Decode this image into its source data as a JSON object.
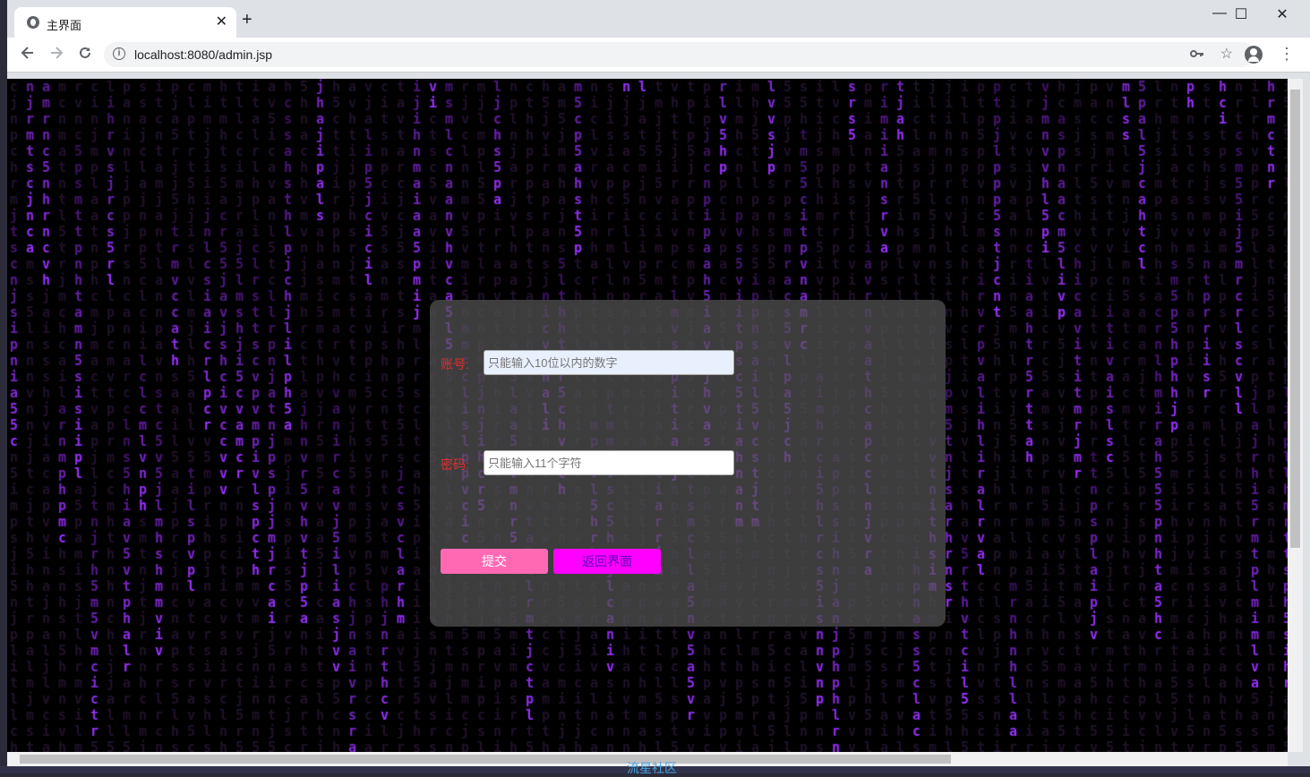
{
  "browser": {
    "tab_title": "主界面",
    "tab_close": "✕",
    "new_tab": "+",
    "url": "localhost:8080/admin.jsp",
    "window_controls": [
      "—",
      "☐",
      "✕"
    ]
  },
  "icons": {
    "back": "arrow-left-icon",
    "forward": "arrow-right-icon",
    "reload": "reload-icon",
    "info": "info-icon",
    "key": "key-icon",
    "star": "star-icon",
    "account": "account-icon",
    "menu": "kebab-menu-icon"
  },
  "form": {
    "account_label": "账号:",
    "account_placeholder": "只能输入10位以内的数字",
    "password_label": "密码:",
    "password_placeholder": "只能输入11个字符",
    "submit_label": "提交",
    "back_label": "返回界面"
  },
  "taskbar_text": "流星社区",
  "colors": {
    "matrix_char": "#9b30ff",
    "panel_bg": "#555555",
    "label_red": "#e32d2d",
    "submit_bg": "#ff69b4",
    "back_bg": "#ff00ff"
  }
}
